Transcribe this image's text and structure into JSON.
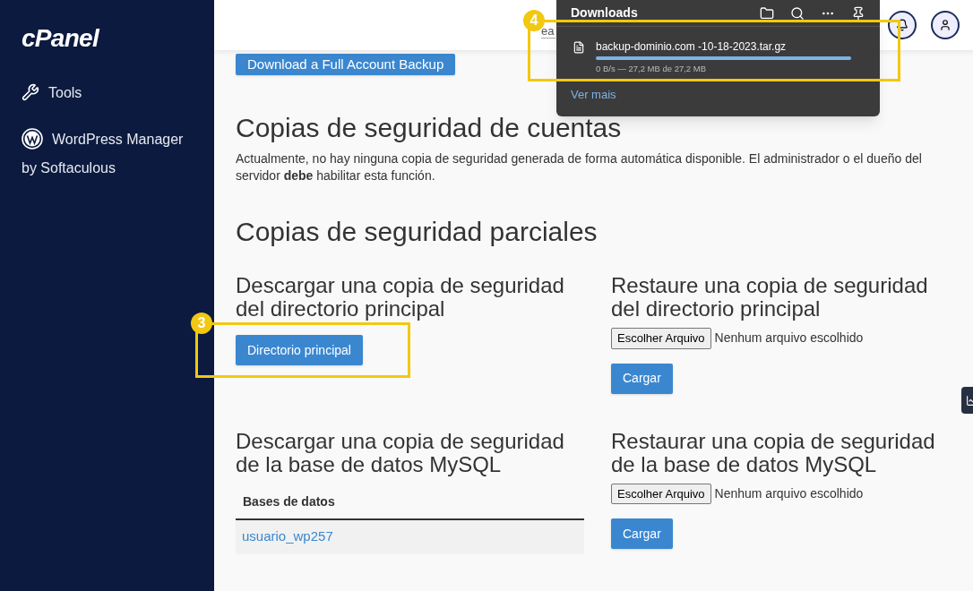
{
  "sidebar": {
    "logo": "cPanel",
    "items": [
      {
        "label": "Tools",
        "kind": "tools"
      },
      {
        "label": "WordPress Manager by Softaculous",
        "kind": "wordpress"
      }
    ]
  },
  "header": {
    "search": {
      "value": "ea"
    }
  },
  "full_backup": {
    "button": "Download a Full Account Backup"
  },
  "account_backups": {
    "title": "Copias de seguridad de cuentas",
    "text": "Actualmente, no hay ninguna copia de seguridad generada de forma automática disponible. El administrador o el dueño del servidor **debe** habilitar esta función."
  },
  "partial_backups": {
    "title": "Copias de seguridad parciales",
    "home": {
      "download_title": "Descargar una copia de seguridad del directorio principal",
      "download_button": "Directorio principal",
      "restore_title": "Restaure una copia de seguridad del directorio principal",
      "file_button": "Escolher Arquivo",
      "file_status": "Nenhum arquivo escolhido",
      "upload_button": "Cargar"
    },
    "mysql": {
      "download_title": "Descargar una copia de seguridad de la base de datos MySQL",
      "table_header": "Bases de datos",
      "databases": [
        "usuario_wp257"
      ],
      "restore_title": "Restaurar una copia de seguridad de la base de datos MySQL",
      "file_button": "Escolher Arquivo",
      "file_status": "Nenhum arquivo escolhido",
      "upload_button": "Cargar"
    }
  },
  "downloads_panel": {
    "title": "Downloads",
    "items": [
      {
        "filename": "backup-dominio.com -10-18-2023.tar.gz",
        "level": 1,
        "status": "0 B/s — 27,2 MB de 27,2 MB"
      }
    ],
    "more_link": "Ver mais"
  },
  "callouts": [
    {
      "number": "3"
    },
    {
      "number": "4"
    }
  ]
}
